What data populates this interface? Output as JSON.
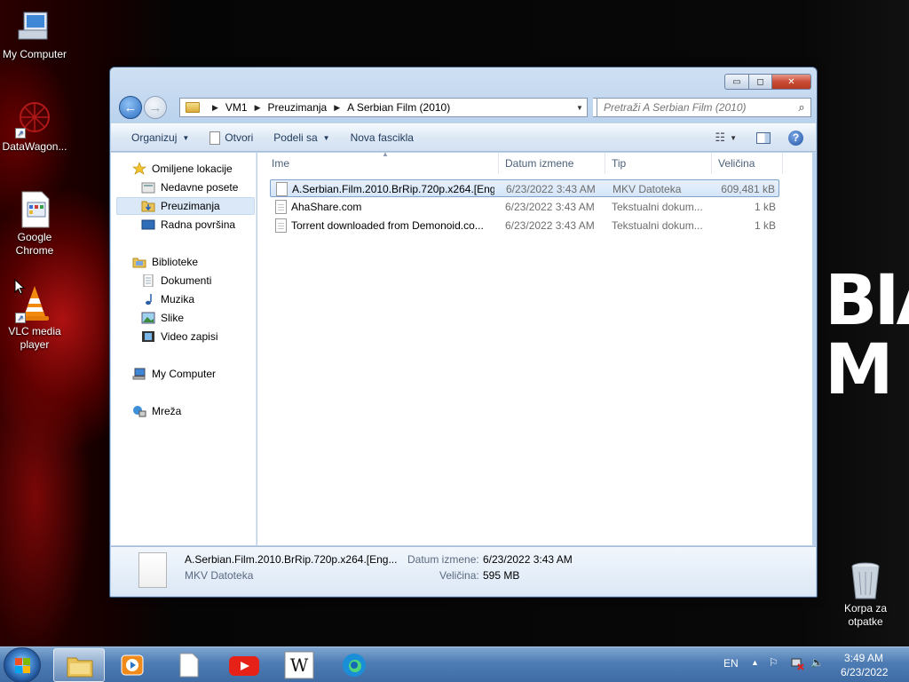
{
  "desktop": {
    "wallpaper_text": [
      "BIA",
      "M"
    ],
    "icons": [
      {
        "label": "My Computer"
      },
      {
        "label": "DataWagon..."
      },
      {
        "label": "Google Chrome"
      },
      {
        "label": "VLC media player"
      },
      {
        "label": "Korpa za otpatke"
      }
    ]
  },
  "window": {
    "controls": {
      "minimize": "▭",
      "maximize": "◻",
      "close": "✕"
    },
    "address": {
      "crumbs": [
        "VM1",
        "Preuzimanja",
        "A Serbian Film (2010)"
      ],
      "separator": "▶",
      "dropdown": "▼"
    },
    "search": {
      "placeholder": "Pretraži A Serbian Film (2010)"
    },
    "toolbar": {
      "organize": "Organizuj",
      "open": "Otvori",
      "share": "Podeli sa",
      "new_folder": "Nova fascikla"
    },
    "nav": {
      "favorites": "Omiljene lokacije",
      "recent": "Nedavne posete",
      "downloads": "Preuzimanja",
      "desktop": "Radna površina",
      "libraries": "Biblioteke",
      "documents": "Dokumenti",
      "music": "Muzika",
      "pictures": "Slike",
      "videos": "Video zapisi",
      "computer": "My Computer",
      "network": "Mreža"
    },
    "columns": {
      "name": "Ime",
      "date": "Datum izmene",
      "type": "Tip",
      "size": "Veličina"
    },
    "files": [
      {
        "name": "A.Serbian.Film.2010.BrRip.720p.x264.[Eng...",
        "date": "6/23/2022 3:43 AM",
        "type": "MKV Datoteka",
        "size": "609,481 kB"
      },
      {
        "name": "AhaShare.com",
        "date": "6/23/2022 3:43 AM",
        "type": "Tekstualni dokum...",
        "size": "1 kB"
      },
      {
        "name": "Torrent downloaded from Demonoid.co...",
        "date": "6/23/2022 3:43 AM",
        "type": "Tekstualni dokum...",
        "size": "1 kB"
      }
    ],
    "details": {
      "name": "A.Serbian.Film.2010.BrRip.720p.x264.[Eng...",
      "type": "MKV Datoteka",
      "date_label": "Datum izmene:",
      "date_value": "6/23/2022 3:43 AM",
      "size_label": "Veličina:",
      "size_value": "595 MB"
    }
  },
  "taskbar": {
    "apps": [
      "file-explorer",
      "media-player",
      "notepad",
      "youtube",
      "wikipedia",
      "edge"
    ],
    "lang": "EN",
    "time": "3:49 AM",
    "date": "6/23/2022"
  }
}
